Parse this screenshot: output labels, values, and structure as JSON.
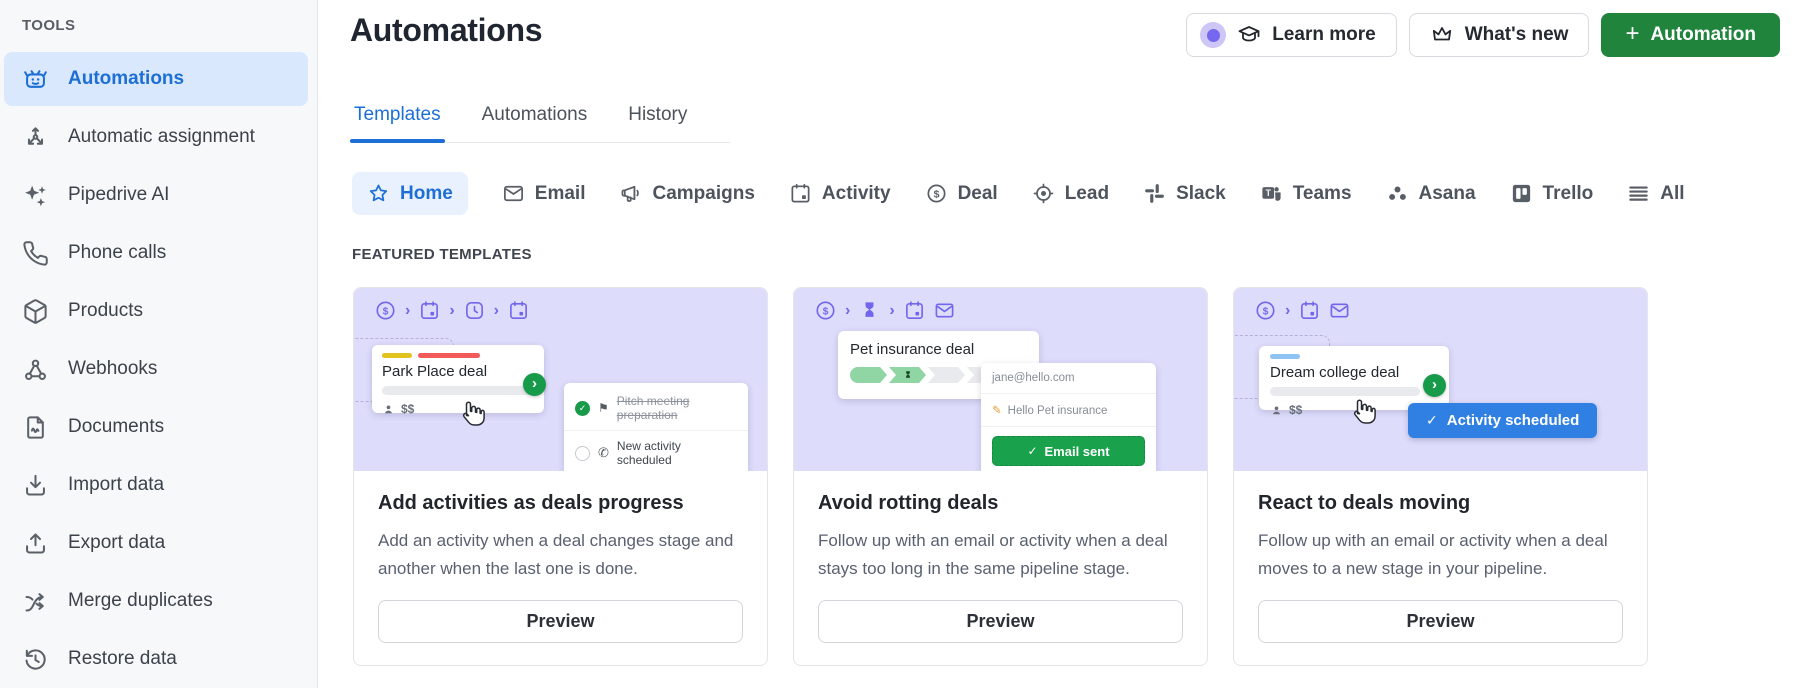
{
  "colors": {
    "accent_blue": "#1d6fd6",
    "primary_green": "#20843c",
    "email_sent_green": "#1aa14c",
    "status_blue": "#2f80e2",
    "illustration_purple": "#7166ec",
    "illustration_bg": "#dedcfb"
  },
  "sidebar": {
    "section_label": "TOOLS",
    "items": [
      {
        "label": "Automations",
        "icon": "robot-icon",
        "active": true
      },
      {
        "label": "Automatic assignment",
        "icon": "assignment-icon",
        "active": false
      },
      {
        "label": "Pipedrive AI",
        "icon": "sparkles-icon",
        "active": false
      },
      {
        "label": "Phone calls",
        "icon": "phone-icon",
        "active": false
      },
      {
        "label": "Products",
        "icon": "box-icon",
        "active": false
      },
      {
        "label": "Webhooks",
        "icon": "webhook-icon",
        "active": false
      },
      {
        "label": "Documents",
        "icon": "document-icon",
        "active": false
      },
      {
        "label": "Import data",
        "icon": "import-icon",
        "active": false
      },
      {
        "label": "Export data",
        "icon": "export-icon",
        "active": false
      },
      {
        "label": "Merge duplicates",
        "icon": "merge-icon",
        "active": false
      },
      {
        "label": "Restore data",
        "icon": "restore-icon",
        "active": false
      }
    ]
  },
  "header": {
    "title": "Automations",
    "learn_more_label": "Learn more",
    "whats_new_label": "What's new",
    "add_plus": "+",
    "add_automation_label": "Automation"
  },
  "tabs": [
    {
      "label": "Templates",
      "active": true
    },
    {
      "label": "Automations",
      "active": false
    },
    {
      "label": "History",
      "active": false
    }
  ],
  "filters": [
    {
      "label": "Home",
      "icon": "star-icon",
      "active": true
    },
    {
      "label": "Email",
      "icon": "email-icon",
      "active": false
    },
    {
      "label": "Campaigns",
      "icon": "megaphone-icon",
      "active": false
    },
    {
      "label": "Activity",
      "icon": "calendar-icon",
      "active": false
    },
    {
      "label": "Deal",
      "icon": "deal-icon",
      "active": false
    },
    {
      "label": "Lead",
      "icon": "lead-icon",
      "active": false
    },
    {
      "label": "Slack",
      "icon": "slack-icon",
      "active": false
    },
    {
      "label": "Teams",
      "icon": "teams-icon",
      "active": false
    },
    {
      "label": "Asana",
      "icon": "asana-icon",
      "active": false
    },
    {
      "label": "Trello",
      "icon": "trello-icon",
      "active": false
    },
    {
      "label": "All",
      "icon": "list-icon",
      "active": false
    }
  ],
  "featured": {
    "section_label": "FEATURED TEMPLATES",
    "cards": [
      {
        "title": "Add activities as deals progress",
        "description": "Add an activity when a deal changes stage and another when the last one is done.",
        "preview_label": "Preview",
        "flow": [
          "deal",
          ">",
          "calendar",
          ">",
          "clock",
          ">",
          "calendar"
        ],
        "deal_card": {
          "name": "Park Place deal",
          "value": "$$"
        },
        "checklist": [
          {
            "text": "Pitch meeting preparation",
            "done": true
          },
          {
            "text": "New activity scheduled",
            "done": false
          }
        ]
      },
      {
        "title": "Avoid rotting deals",
        "description": "Follow up with an email or activity when a deal stays too long in the same pipeline stage.",
        "preview_label": "Preview",
        "flow": [
          "deal",
          ">",
          "hourglass",
          ">",
          "calendar",
          "mail"
        ],
        "deal_card": {
          "name": "Pet insurance deal"
        },
        "email_popup": {
          "to": "jane@hello.com",
          "subject": "Hello Pet insurance",
          "button_label": "Email sent"
        }
      },
      {
        "title": "React to deals moving",
        "description": "Follow up with an email or activity when a deal moves to a new stage in your pipeline.",
        "preview_label": "Preview",
        "flow": [
          "deal",
          ">",
          "calendar",
          "mail"
        ],
        "deal_card": {
          "name": "Dream college deal",
          "value": "$$"
        },
        "status_button_label": "Activity scheduled"
      }
    ]
  }
}
